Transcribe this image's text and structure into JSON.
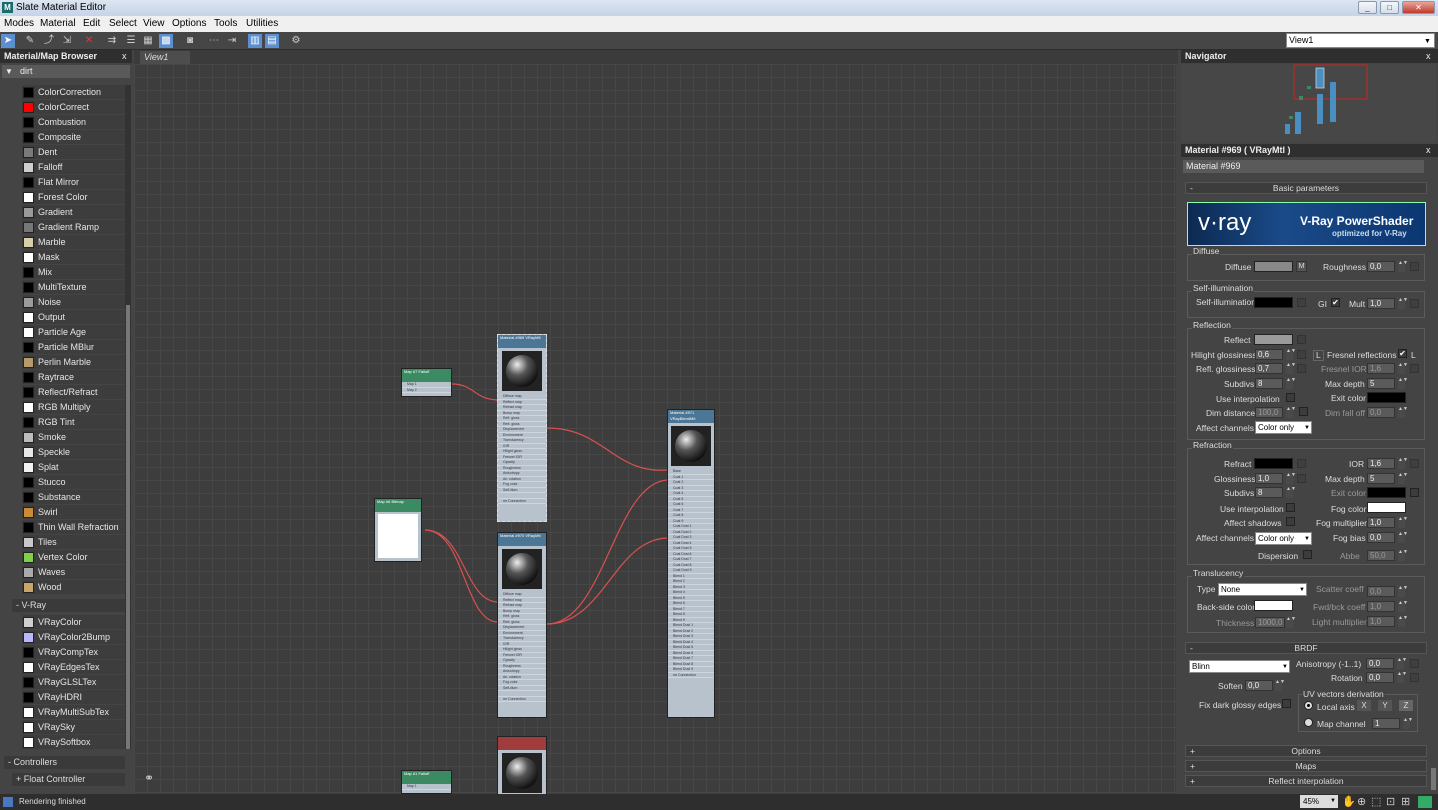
{
  "window": {
    "title": "Slate Material Editor",
    "min": "_",
    "max": "□",
    "close": "✕"
  },
  "menu": [
    "Modes",
    "Material",
    "Edit",
    "Select",
    "View",
    "Options",
    "Tools",
    "Utilities"
  ],
  "view_select": "View1",
  "browser": {
    "title": "Material/Map Browser",
    "close": "x",
    "filter": "dirt",
    "maps": [
      {
        "label": "ColorCorrection",
        "color": "#000000"
      },
      {
        "label": "ColorCorrect",
        "color": "#ff0000"
      },
      {
        "label": "Combustion",
        "color": "#000000"
      },
      {
        "label": "Composite",
        "color": "#000000"
      },
      {
        "label": "Dent",
        "color": "#7a7a7a"
      },
      {
        "label": "Falloff",
        "color": "#cfcfcf"
      },
      {
        "label": "Flat Mirror",
        "color": "#000000"
      },
      {
        "label": "Forest Color",
        "color": "#ffffff"
      },
      {
        "label": "Gradient",
        "color": "#9a9a9a"
      },
      {
        "label": "Gradient Ramp",
        "color": "#777777"
      },
      {
        "label": "Marble",
        "color": "#d8cfa8"
      },
      {
        "label": "Mask",
        "color": "#ffffff"
      },
      {
        "label": "Mix",
        "color": "#000000"
      },
      {
        "label": "MultiTexture",
        "color": "#000000"
      },
      {
        "label": "Noise",
        "color": "#9c9c9c"
      },
      {
        "label": "Output",
        "color": "#ffffff"
      },
      {
        "label": "Particle Age",
        "color": "#ffffff"
      },
      {
        "label": "Particle MBlur",
        "color": "#000000"
      },
      {
        "label": "Perlin Marble",
        "color": "#b59a6a"
      },
      {
        "label": "Raytrace",
        "color": "#000000"
      },
      {
        "label": "Reflect/Refract",
        "color": "#000000"
      },
      {
        "label": "RGB Multiply",
        "color": "#ffffff"
      },
      {
        "label": "RGB Tint",
        "color": "#000000"
      },
      {
        "label": "Smoke",
        "color": "#bdbdbd"
      },
      {
        "label": "Speckle",
        "color": "#e8e8e8"
      },
      {
        "label": "Splat",
        "color": "#f2f2f2"
      },
      {
        "label": "Stucco",
        "color": "#000000"
      },
      {
        "label": "Substance",
        "color": "#000000"
      },
      {
        "label": "Swirl",
        "color": "#c98a3a"
      },
      {
        "label": "Thin Wall Refraction",
        "color": "#000000"
      },
      {
        "label": "Tiles",
        "color": "#c8c8c8"
      },
      {
        "label": "Vertex Color",
        "color": "#7fd046"
      },
      {
        "label": "Waves",
        "color": "#aaaaaa"
      },
      {
        "label": "Wood",
        "color": "#c9a56a"
      }
    ],
    "group_vray": "- V-Ray",
    "vray_maps": [
      {
        "label": "VRayColor",
        "color": "#cfcfcf"
      },
      {
        "label": "VRayColor2Bump",
        "color": "#b8b8ff"
      },
      {
        "label": "VRayCompTex",
        "color": "#000000"
      },
      {
        "label": "VRayEdgesTex",
        "color": "#ffffff"
      },
      {
        "label": "VRayGLSLTex",
        "color": "#000000"
      },
      {
        "label": "VRayHDRI",
        "color": "#000000"
      },
      {
        "label": "VRayMultiSubTex",
        "color": "#ffffff"
      },
      {
        "label": "VRaySky",
        "color": "#ffffff"
      },
      {
        "label": "VRaySoftbox",
        "color": "#ffffff"
      }
    ],
    "group_controllers": "- Controllers",
    "group_float": "+ Float Controller"
  },
  "view_tab": "View1",
  "nodes": [
    {
      "title": "Map #7\nFalloff",
      "slots": [
        "Map 1",
        "Map 2"
      ]
    },
    {
      "title": "Material #969\nVRayMtl",
      "slots": [
        "Diffuse map",
        "Reflect map",
        "Refract map",
        "Bump map",
        "Refl. gloss",
        "Refr. gloss",
        "Displacement",
        "Environment",
        "Translucency",
        "IOR",
        "Hilight gloss",
        "Fresnel IOR",
        "Opacity",
        "Roughness",
        "Anisotropy",
        "An. rotation",
        "Fog color",
        "Self-illum",
        "",
        "mr Connection"
      ]
    },
    {
      "title": "Map #6\nBitmap",
      "slots": []
    },
    {
      "title": "Material #970\nVRayMtl",
      "slots": [
        "Diffuse map",
        "Reflect map",
        "Refract map",
        "Bump map",
        "Refl. gloss",
        "Refr. gloss",
        "Displacement",
        "Environment",
        "Translucency",
        "IOR",
        "Hilight gloss",
        "Fresnel IOR",
        "Opacity",
        "Roughness",
        "Anisotropy",
        "An. rotation",
        "Fog color",
        "Self-illum",
        "",
        "mr Connection"
      ]
    },
    {
      "title": "Material #971\nVRayBlendMtl",
      "slots": [
        "Base",
        "Coat 1",
        "Coat 2",
        "Coat 3",
        "Coat 4",
        "Coat 5",
        "Coat 6",
        "Coat 7",
        "Coat 8",
        "Coat 9",
        "Coat Dust 1",
        "Coat Dust 2",
        "Coat Dust 3",
        "Coat Dust 4",
        "Coat Dust 5",
        "Coat Dust 6",
        "Coat Dust 7",
        "Coat Dust 8",
        "Coat Dust 9",
        "Blend 1",
        "Blend 2",
        "Blend 3",
        "Blend 4",
        "Blend 5",
        "Blend 6",
        "Blend 7",
        "Blend 8",
        "Blend 9",
        "Blend Dust 1",
        "Blend Dust 2",
        "Blend Dust 3",
        "Blend Dust 4",
        "Blend Dust 5",
        "Blend Dust 6",
        "Blend Dust 7",
        "Blend Dust 8",
        "Blend Dust 9",
        "mr Connection"
      ]
    },
    {
      "title": "Map #1\nFalloff",
      "slots": [
        "Map 1"
      ]
    }
  ],
  "navigator": {
    "title": "Navigator",
    "close": "x"
  },
  "params": {
    "header": "Material #969  ( VRayMtl )",
    "name_field": "Material #969",
    "basic": "Basic parameters",
    "banner_title": "V-Ray PowerShader",
    "banner_sub": "optimized for V-Ray",
    "banner_logo": "v·ray",
    "diffuse": {
      "group": "Diffuse",
      "diffuse": "Diffuse",
      "m": "M",
      "roughness": "Roughness",
      "roughness_val": "0,0",
      "color": "#888888"
    },
    "selfillum": {
      "group": "Self-illumination",
      "label": "Self-illumination",
      "gi": "GI",
      "mult": "Mult",
      "mult_val": "1,0",
      "color": "#000000"
    },
    "reflection": {
      "group": "Reflection",
      "reflect": "Reflect",
      "reflect_color": "#9a9a9a",
      "hilight": "Hilight glossiness",
      "hilight_val": "0,6",
      "L": "L",
      "fresnel": "Fresnel reflections",
      "refl_gloss": "Refl. glossiness",
      "refl_gloss_val": "0,7",
      "fresnel_ior": "Fresnel IOR",
      "fresnel_ior_val": "1,6",
      "subdivs": "Subdivs",
      "subdivs_val": "8",
      "max_depth": "Max depth",
      "max_depth_val": "5",
      "use_interp": "Use interpolation",
      "exit_color": "Exit color",
      "dim_distance": "Dim distance",
      "dim_distance_val": "100,0",
      "dim_falloff": "Dim fall off",
      "dim_falloff_val": "0,0",
      "affect": "Affect channels",
      "affect_val": "Color only"
    },
    "refraction": {
      "group": "Refraction",
      "refract": "Refract",
      "ior": "IOR",
      "ior_val": "1,6",
      "gloss": "Glossiness",
      "gloss_val": "1,0",
      "max_depth": "Max depth",
      "max_depth_val": "5",
      "subdivs": "Subdivs",
      "subdivs_val": "8",
      "exit_color": "Exit color",
      "use_interp": "Use interpolation",
      "fog_color": "Fog color",
      "affect_shadows": "Affect shadows",
      "fog_mult": "Fog multiplier",
      "fog_mult_val": "1,0",
      "affect": "Affect channels",
      "affect_val": "Color only",
      "fog_bias": "Fog bias",
      "fog_bias_val": "0,0",
      "dispersion": "Dispersion",
      "abbe": "Abbe",
      "abbe_val": "50,0"
    },
    "translucency": {
      "group": "Translucency",
      "type": "Type",
      "type_val": "None",
      "scatter": "Scatter coeff",
      "scatter_val": "0,0",
      "backside": "Back-side color",
      "fwd": "Fwd/bck coeff",
      "fwd_val": "1,0",
      "thickness": "Thickness",
      "thickness_val": "1000,0",
      "light_mult": "Light multiplier",
      "light_mult_val": "1,0"
    },
    "brdf": {
      "title": "BRDF",
      "type_val": "Blinn",
      "aniso": "Anisotropy (-1..1)",
      "aniso_val": "0,0",
      "rotation": "Rotation",
      "rotation_val": "0,0",
      "soften": "Soften",
      "soften_val": "0,0",
      "uv_group": "UV vectors derivation",
      "local_axis": "Local axis",
      "x": "X",
      "y": "Y",
      "z": "Z",
      "fix_dark": "Fix dark glossy edges",
      "map_channel": "Map channel",
      "map_channel_val": "1"
    },
    "rollouts": [
      "Options",
      "Maps",
      "Reflect interpolation"
    ]
  },
  "status": {
    "text": "Rendering finished",
    "zoom": "45%"
  }
}
